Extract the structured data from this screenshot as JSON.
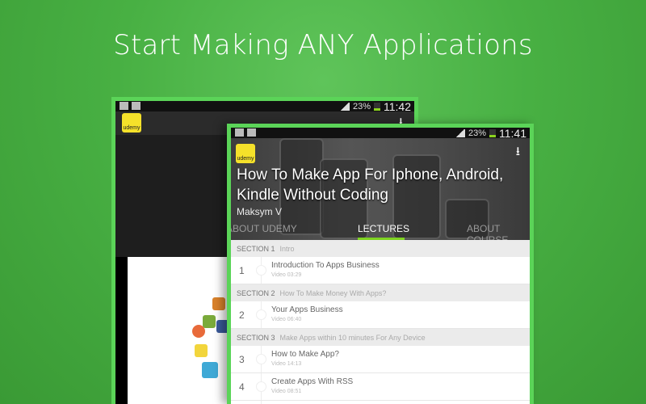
{
  "headline": "Start Making ANY Applications",
  "back_phone": {
    "battery": "23%",
    "time": "11:42",
    "logo_text": "udemy"
  },
  "front_phone": {
    "battery": "23%",
    "time": "11:41",
    "logo_text": "udemy",
    "course_title": "How To Make App For Iphone, Android, Kindle Without Coding",
    "author": "Maksym V",
    "tabs": [
      "ABOUT UDEMY",
      "LECTURES",
      "ABOUT COURSE"
    ],
    "sections": [
      {
        "label": "SECTION 1",
        "title": "Intro",
        "lectures": [
          {
            "num": "1",
            "title": "Introduction To Apps Business",
            "meta": "Video 03:29"
          }
        ]
      },
      {
        "label": "SECTION 2",
        "title": "How To Make Money With Apps?",
        "lectures": [
          {
            "num": "2",
            "title": "Your Apps Business",
            "meta": "Video 06:40"
          }
        ]
      },
      {
        "label": "SECTION 3",
        "title": "Make Apps within 10 minutes For Any Device",
        "lectures": [
          {
            "num": "3",
            "title": "How to Make App?",
            "meta": "Video 14:13"
          },
          {
            "num": "4",
            "title": "Create Apps With RSS",
            "meta": "Video 08:51"
          }
        ]
      }
    ]
  },
  "colors": {
    "frame": "#5bd458",
    "accent": "#7ed321",
    "background": "#48b043"
  }
}
